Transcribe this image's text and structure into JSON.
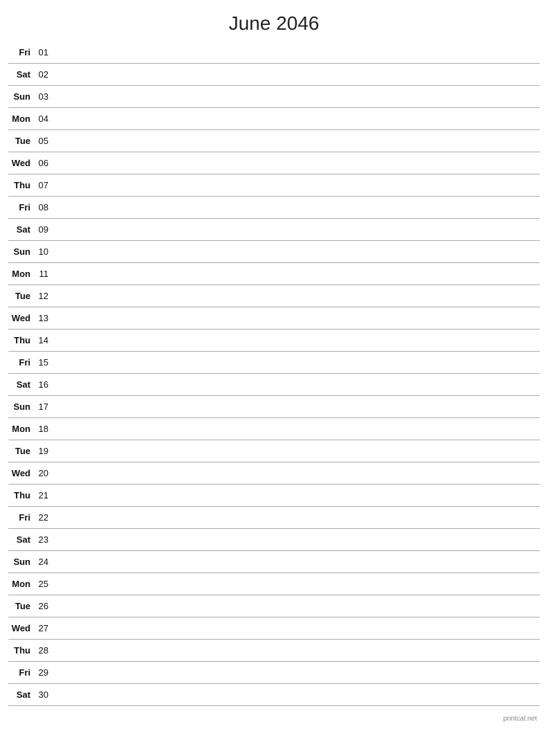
{
  "title": "June 2046",
  "footer": "printcal.net",
  "days": [
    {
      "name": "Fri",
      "number": "01"
    },
    {
      "name": "Sat",
      "number": "02"
    },
    {
      "name": "Sun",
      "number": "03"
    },
    {
      "name": "Mon",
      "number": "04"
    },
    {
      "name": "Tue",
      "number": "05"
    },
    {
      "name": "Wed",
      "number": "06"
    },
    {
      "name": "Thu",
      "number": "07"
    },
    {
      "name": "Fri",
      "number": "08"
    },
    {
      "name": "Sat",
      "number": "09"
    },
    {
      "name": "Sun",
      "number": "10"
    },
    {
      "name": "Mon",
      "number": "11"
    },
    {
      "name": "Tue",
      "number": "12"
    },
    {
      "name": "Wed",
      "number": "13"
    },
    {
      "name": "Thu",
      "number": "14"
    },
    {
      "name": "Fri",
      "number": "15"
    },
    {
      "name": "Sat",
      "number": "16"
    },
    {
      "name": "Sun",
      "number": "17"
    },
    {
      "name": "Mon",
      "number": "18"
    },
    {
      "name": "Tue",
      "number": "19"
    },
    {
      "name": "Wed",
      "number": "20"
    },
    {
      "name": "Thu",
      "number": "21"
    },
    {
      "name": "Fri",
      "number": "22"
    },
    {
      "name": "Sat",
      "number": "23"
    },
    {
      "name": "Sun",
      "number": "24"
    },
    {
      "name": "Mon",
      "number": "25"
    },
    {
      "name": "Tue",
      "number": "26"
    },
    {
      "name": "Wed",
      "number": "27"
    },
    {
      "name": "Thu",
      "number": "28"
    },
    {
      "name": "Fri",
      "number": "29"
    },
    {
      "name": "Sat",
      "number": "30"
    }
  ]
}
